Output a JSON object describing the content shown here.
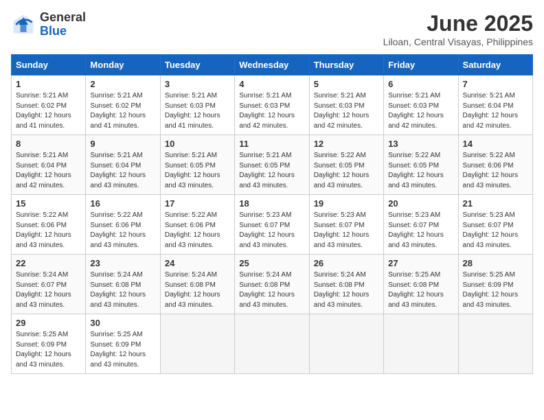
{
  "logo": {
    "general": "General",
    "blue": "Blue"
  },
  "title": "June 2025",
  "location": "Liloan, Central Visayas, Philippines",
  "days_header": [
    "Sunday",
    "Monday",
    "Tuesday",
    "Wednesday",
    "Thursday",
    "Friday",
    "Saturday"
  ],
  "weeks": [
    [
      {
        "day": "1",
        "sunrise": "5:21 AM",
        "sunset": "6:02 PM",
        "daylight": "12 hours and 41 minutes."
      },
      {
        "day": "2",
        "sunrise": "5:21 AM",
        "sunset": "6:02 PM",
        "daylight": "12 hours and 41 minutes."
      },
      {
        "day": "3",
        "sunrise": "5:21 AM",
        "sunset": "6:03 PM",
        "daylight": "12 hours and 41 minutes."
      },
      {
        "day": "4",
        "sunrise": "5:21 AM",
        "sunset": "6:03 PM",
        "daylight": "12 hours and 42 minutes."
      },
      {
        "day": "5",
        "sunrise": "5:21 AM",
        "sunset": "6:03 PM",
        "daylight": "12 hours and 42 minutes."
      },
      {
        "day": "6",
        "sunrise": "5:21 AM",
        "sunset": "6:03 PM",
        "daylight": "12 hours and 42 minutes."
      },
      {
        "day": "7",
        "sunrise": "5:21 AM",
        "sunset": "6:04 PM",
        "daylight": "12 hours and 42 minutes."
      }
    ],
    [
      {
        "day": "8",
        "sunrise": "5:21 AM",
        "sunset": "6:04 PM",
        "daylight": "12 hours and 42 minutes."
      },
      {
        "day": "9",
        "sunrise": "5:21 AM",
        "sunset": "6:04 PM",
        "daylight": "12 hours and 43 minutes."
      },
      {
        "day": "10",
        "sunrise": "5:21 AM",
        "sunset": "6:05 PM",
        "daylight": "12 hours and 43 minutes."
      },
      {
        "day": "11",
        "sunrise": "5:21 AM",
        "sunset": "6:05 PM",
        "daylight": "12 hours and 43 minutes."
      },
      {
        "day": "12",
        "sunrise": "5:22 AM",
        "sunset": "6:05 PM",
        "daylight": "12 hours and 43 minutes."
      },
      {
        "day": "13",
        "sunrise": "5:22 AM",
        "sunset": "6:05 PM",
        "daylight": "12 hours and 43 minutes."
      },
      {
        "day": "14",
        "sunrise": "5:22 AM",
        "sunset": "6:06 PM",
        "daylight": "12 hours and 43 minutes."
      }
    ],
    [
      {
        "day": "15",
        "sunrise": "5:22 AM",
        "sunset": "6:06 PM",
        "daylight": "12 hours and 43 minutes."
      },
      {
        "day": "16",
        "sunrise": "5:22 AM",
        "sunset": "6:06 PM",
        "daylight": "12 hours and 43 minutes."
      },
      {
        "day": "17",
        "sunrise": "5:22 AM",
        "sunset": "6:06 PM",
        "daylight": "12 hours and 43 minutes."
      },
      {
        "day": "18",
        "sunrise": "5:23 AM",
        "sunset": "6:07 PM",
        "daylight": "12 hours and 43 minutes."
      },
      {
        "day": "19",
        "sunrise": "5:23 AM",
        "sunset": "6:07 PM",
        "daylight": "12 hours and 43 minutes."
      },
      {
        "day": "20",
        "sunrise": "5:23 AM",
        "sunset": "6:07 PM",
        "daylight": "12 hours and 43 minutes."
      },
      {
        "day": "21",
        "sunrise": "5:23 AM",
        "sunset": "6:07 PM",
        "daylight": "12 hours and 43 minutes."
      }
    ],
    [
      {
        "day": "22",
        "sunrise": "5:24 AM",
        "sunset": "6:07 PM",
        "daylight": "12 hours and 43 minutes."
      },
      {
        "day": "23",
        "sunrise": "5:24 AM",
        "sunset": "6:08 PM",
        "daylight": "12 hours and 43 minutes."
      },
      {
        "day": "24",
        "sunrise": "5:24 AM",
        "sunset": "6:08 PM",
        "daylight": "12 hours and 43 minutes."
      },
      {
        "day": "25",
        "sunrise": "5:24 AM",
        "sunset": "6:08 PM",
        "daylight": "12 hours and 43 minutes."
      },
      {
        "day": "26",
        "sunrise": "5:24 AM",
        "sunset": "6:08 PM",
        "daylight": "12 hours and 43 minutes."
      },
      {
        "day": "27",
        "sunrise": "5:25 AM",
        "sunset": "6:08 PM",
        "daylight": "12 hours and 43 minutes."
      },
      {
        "day": "28",
        "sunrise": "5:25 AM",
        "sunset": "6:09 PM",
        "daylight": "12 hours and 43 minutes."
      }
    ],
    [
      {
        "day": "29",
        "sunrise": "5:25 AM",
        "sunset": "6:09 PM",
        "daylight": "12 hours and 43 minutes."
      },
      {
        "day": "30",
        "sunrise": "5:25 AM",
        "sunset": "6:09 PM",
        "daylight": "12 hours and 43 minutes."
      },
      null,
      null,
      null,
      null,
      null
    ]
  ]
}
